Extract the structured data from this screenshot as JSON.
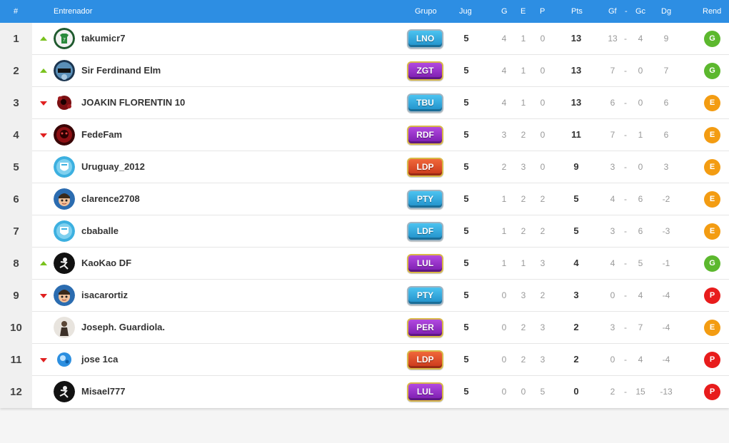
{
  "header": {
    "pos": "#",
    "coach": "Entrenador",
    "group": "Grupo",
    "played": "Jug",
    "won": "G",
    "drawn": "E",
    "lost": "P",
    "points": "Pts",
    "gf": "Gf",
    "sep": "-",
    "gc": "Gc",
    "dg": "Dg",
    "form": "Rend"
  },
  "colors": {
    "header_bg": "#2d8ee3",
    "trend_up": "#7ac21e",
    "trend_down": "#e02020",
    "form_G": "#5cb82e",
    "form_E": "#f39c12",
    "form_P": "#e81c1c",
    "group_blue": "#2a9fd8",
    "group_purple": "#8e2bc0",
    "group_orange": "#e5572a"
  },
  "rows": [
    {
      "pos": "1",
      "trend": "up",
      "avatar": "green-shirt-avatar-icon",
      "name": "takumicr7",
      "group": "LNO",
      "group_color": "blue",
      "played": "5",
      "won": "4",
      "drawn": "1",
      "lost": "0",
      "points": "13",
      "gf": "13",
      "sep": "-",
      "gc": "4",
      "dg": "9",
      "form": "G"
    },
    {
      "pos": "2",
      "trend": "up",
      "avatar": "blue-crest-avatar-icon",
      "name": "Sir Ferdinand Elm",
      "group": "ZGT",
      "group_color": "purple",
      "played": "5",
      "won": "4",
      "drawn": "1",
      "lost": "0",
      "points": "13",
      "gf": "7",
      "sep": "-",
      "gc": "0",
      "dg": "7",
      "form": "G"
    },
    {
      "pos": "3",
      "trend": "down",
      "avatar": "red-splatter-avatar-icon",
      "name": "JOAKIN FLORENTIN 10",
      "group": "TBU",
      "group_color": "blue",
      "played": "5",
      "won": "4",
      "drawn": "1",
      "lost": "0",
      "points": "13",
      "gf": "6",
      "sep": "-",
      "gc": "0",
      "dg": "6",
      "form": "E"
    },
    {
      "pos": "4",
      "trend": "down",
      "avatar": "red-dark-avatar-icon",
      "name": "FedeFam",
      "group": "RDF",
      "group_color": "purple",
      "played": "5",
      "won": "3",
      "drawn": "2",
      "lost": "0",
      "points": "11",
      "gf": "7",
      "sep": "-",
      "gc": "1",
      "dg": "6",
      "form": "E"
    },
    {
      "pos": "5",
      "trend": "none",
      "avatar": "sky-crest-avatar-icon",
      "name": "Uruguay_2012",
      "group": "LDP",
      "group_color": "orange",
      "played": "5",
      "won": "2",
      "drawn": "3",
      "lost": "0",
      "points": "9",
      "gf": "3",
      "sep": "-",
      "gc": "0",
      "dg": "3",
      "form": "E"
    },
    {
      "pos": "6",
      "trend": "none",
      "avatar": "cartoon-face-avatar-icon",
      "name": "clarence2708",
      "group": "PTY",
      "group_color": "blue",
      "played": "5",
      "won": "1",
      "drawn": "2",
      "lost": "2",
      "points": "5",
      "gf": "4",
      "sep": "-",
      "gc": "6",
      "dg": "-2",
      "form": "E"
    },
    {
      "pos": "7",
      "trend": "none",
      "avatar": "sky-crest-avatar-icon",
      "name": "cbaballe",
      "group": "LDF",
      "group_color": "blue",
      "played": "5",
      "won": "1",
      "drawn": "2",
      "lost": "2",
      "points": "5",
      "gf": "3",
      "sep": "-",
      "gc": "6",
      "dg": "-3",
      "form": "E"
    },
    {
      "pos": "8",
      "trend": "up",
      "avatar": "bw-figure-avatar-icon",
      "name": "KaoKao DF",
      "group": "LUL",
      "group_color": "purple",
      "played": "5",
      "won": "1",
      "drawn": "1",
      "lost": "3",
      "points": "4",
      "gf": "4",
      "sep": "-",
      "gc": "5",
      "dg": "-1",
      "form": "G"
    },
    {
      "pos": "9",
      "trend": "down",
      "avatar": "cartoon-face-avatar-icon",
      "name": "isacarortiz",
      "group": "PTY",
      "group_color": "blue",
      "played": "5",
      "won": "0",
      "drawn": "3",
      "lost": "2",
      "points": "3",
      "gf": "0",
      "sep": "-",
      "gc": "4",
      "dg": "-4",
      "form": "P"
    },
    {
      "pos": "10",
      "trend": "none",
      "avatar": "photo-person-avatar-icon",
      "name": "Joseph. Guardiola.",
      "group": "PER",
      "group_color": "purple",
      "played": "5",
      "won": "0",
      "drawn": "2",
      "lost": "3",
      "points": "2",
      "gf": "3",
      "sep": "-",
      "gc": "7",
      "dg": "-4",
      "form": "E"
    },
    {
      "pos": "11",
      "trend": "down",
      "avatar": "blue-swirl-avatar-icon",
      "name": "jose 1ca",
      "group": "LDP",
      "group_color": "orange",
      "played": "5",
      "won": "0",
      "drawn": "2",
      "lost": "3",
      "points": "2",
      "gf": "0",
      "sep": "-",
      "gc": "4",
      "dg": "-4",
      "form": "P"
    },
    {
      "pos": "12",
      "trend": "none",
      "avatar": "bw-figure-avatar-icon",
      "name": "Misael777",
      "group": "LUL",
      "group_color": "purple",
      "played": "5",
      "won": "0",
      "drawn": "0",
      "lost": "5",
      "points": "0",
      "gf": "2",
      "sep": "-",
      "gc": "15",
      "dg": "-13",
      "form": "P"
    }
  ]
}
